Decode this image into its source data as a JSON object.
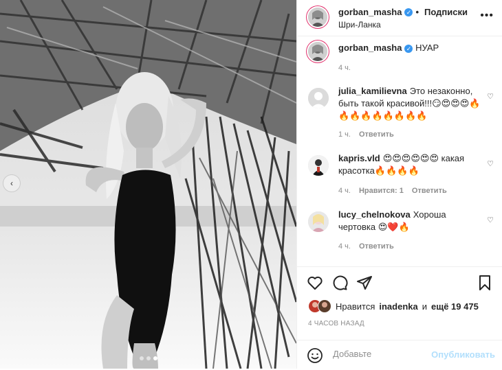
{
  "post": {
    "author": "gorban_masha",
    "follow_separator": "•",
    "follow_label": "Подписки",
    "location": "Шри-Ланка",
    "more_label": "•••",
    "caption": {
      "author": "gorban_masha",
      "text": "НУАР",
      "time": "4 ч."
    },
    "carousel": {
      "slides": 3,
      "active_index": 2,
      "prev_label": "‹"
    }
  },
  "comments": [
    {
      "user": "julia_kamilievna",
      "text": "Это незаконно, быть такой красивой!!!😏😍😍😍🔥🔥🔥🔥🔥🔥🔥🔥🔥",
      "time": "1 ч.",
      "likes_label": "",
      "reply_label": "Ответить"
    },
    {
      "user": "kapris.vld",
      "text": "😍😍😍😍😍😍 какая красотка🔥🔥🔥🔥",
      "time": "4 ч.",
      "likes_label": "Нравится: 1",
      "reply_label": "Ответить"
    },
    {
      "user": "lucy_chelnokova",
      "text": "Хороша чертовка 😍❤️🔥",
      "time": "4 ч.",
      "likes_label": "",
      "reply_label": "Ответить"
    }
  ],
  "likes": {
    "prefix": "Нравится",
    "user": "inadenka",
    "connector": "и",
    "count_text": "ещё 19 475"
  },
  "time_ago": "4 ЧАСОВ НАЗАД",
  "add_comment": {
    "placeholder": "Добавьте",
    "publish_label": "Опубликовать"
  },
  "icons": {
    "like": "heart-icon",
    "comment": "comment-icon",
    "share": "paper-plane-icon",
    "save": "bookmark-icon",
    "emoji": "smiley-icon",
    "verified": "verified-badge-icon"
  },
  "colors": {
    "verified": "#3897f0",
    "publish_disabled": "#b2dffc",
    "muted": "#8e8e8e",
    "text": "#262626"
  }
}
